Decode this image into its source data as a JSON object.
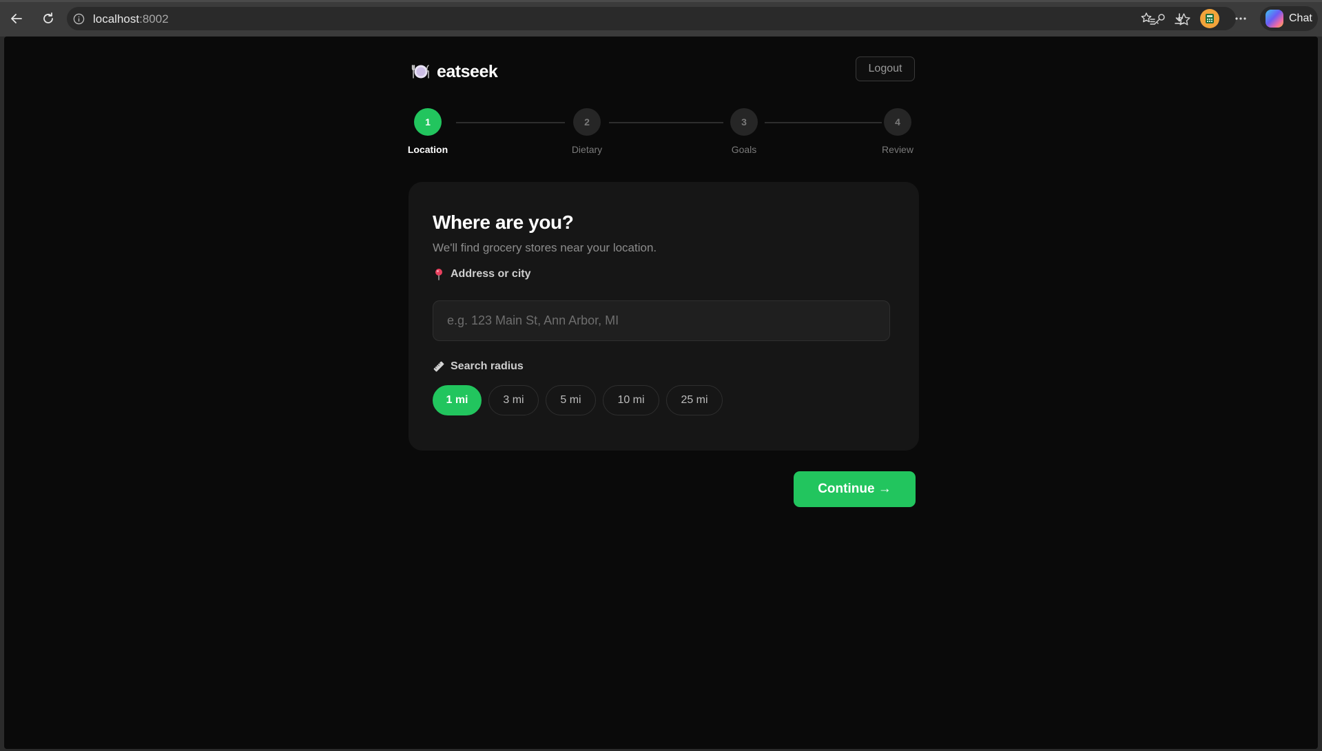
{
  "browser": {
    "url_host": "localhost",
    "url_port": ":8002",
    "chat_label": "Chat"
  },
  "app": {
    "brand_name": "eatseek",
    "brand_icon": "plate-cutlery-icon",
    "logout_label": "Logout"
  },
  "stepper": {
    "steps": [
      {
        "number": "1",
        "label": "Location",
        "active": true
      },
      {
        "number": "2",
        "label": "Dietary",
        "active": false
      },
      {
        "number": "3",
        "label": "Goals",
        "active": false
      },
      {
        "number": "4",
        "label": "Review",
        "active": false
      }
    ]
  },
  "card": {
    "title": "Where are you?",
    "subtitle": "We'll find grocery stores near your location.",
    "address": {
      "label": "Address or city",
      "icon": "map-pin-icon",
      "value": "",
      "placeholder": "e.g. 123 Main St, Ann Arbor, MI"
    },
    "radius": {
      "label": "Search radius",
      "icon": "ruler-icon",
      "options": [
        "1 mi",
        "3 mi",
        "5 mi",
        "10 mi",
        "25 mi"
      ],
      "selected": "1 mi"
    }
  },
  "continue_label": "Continue →",
  "colors": {
    "accent": "#22c55e",
    "background": "#0a0a0a",
    "card": "#161616"
  }
}
